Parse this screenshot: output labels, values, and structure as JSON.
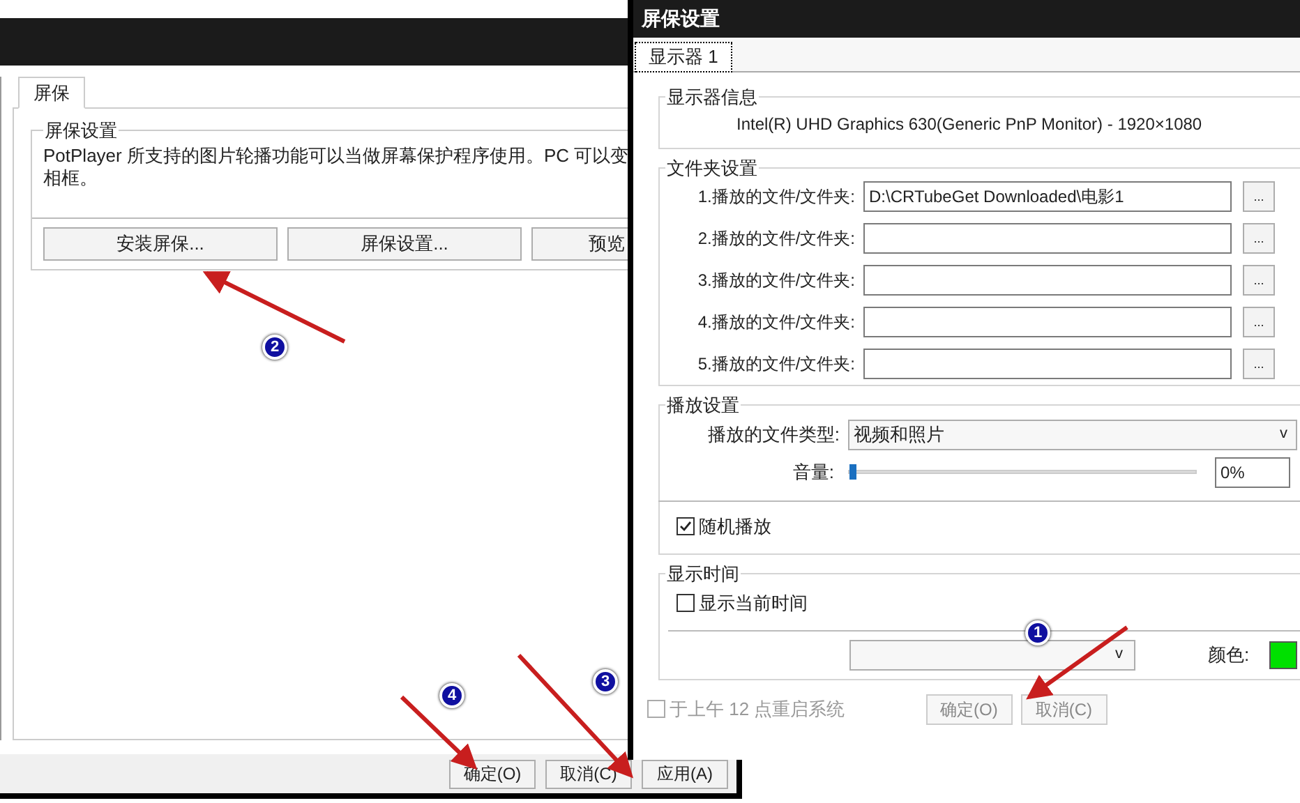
{
  "background_window": {
    "tabs": [
      {
        "label": "屏保",
        "selected": true
      }
    ],
    "group": {
      "title": "屏保设置",
      "lines": [
        "PotPlayer 所支持的图片轮播功能可以当做屏幕保护程序使用。PC 可以变",
        "相框。"
      ],
      "buttons": [
        "安装屏保...",
        "屏保设置...",
        "预览"
      ]
    },
    "footer_buttons": [
      "确定(O)",
      "取消(C)",
      "应用(A)"
    ]
  },
  "dialog": {
    "title": "屏保设置",
    "tabs": [
      {
        "label": "显示器 1",
        "selected": true
      }
    ],
    "monitor_info": {
      "title": "显示器信息",
      "text": "Intel(R) UHD Graphics 630(Generic PnP Monitor) - 1920×1080"
    },
    "folders": {
      "title": "文件夹设置",
      "rows": [
        {
          "label": "1.播放的文件/文件夹:",
          "value": "D:\\CRTubeGet Downloaded\\电影1",
          "browse": "..."
        },
        {
          "label": "2.播放的文件/文件夹:",
          "value": "",
          "browse": "..."
        },
        {
          "label": "3.播放的文件/文件夹:",
          "value": "",
          "browse": "..."
        },
        {
          "label": "4.播放的文件/文件夹:",
          "value": "",
          "browse": "..."
        },
        {
          "label": "5.播放的文件/文件夹:",
          "value": "",
          "browse": "..."
        }
      ]
    },
    "playback": {
      "title": "播放设置",
      "file_type_label": "播放的文件类型:",
      "file_type_value": "视频和照片",
      "dropdown_caret": "v",
      "volume_label": "音量:",
      "level": 0,
      "volume_reading": "0%",
      "shuffle": {
        "label": "随机播放",
        "checked": true
      }
    },
    "display_time": {
      "title": "显示时间",
      "show_time": {
        "label": "显示当前时间",
        "checked": false
      },
      "format_caret": "v",
      "color_label": "颜色:",
      "color": "#00e000"
    },
    "restart": {
      "label": "于上午 12 点重启系统",
      "checked": false
    },
    "buttons": [
      "确定(O)",
      "取消(C)"
    ]
  },
  "annotations": [
    {
      "number": "1"
    },
    {
      "number": "2"
    },
    {
      "number": "3"
    },
    {
      "number": "4"
    }
  ]
}
